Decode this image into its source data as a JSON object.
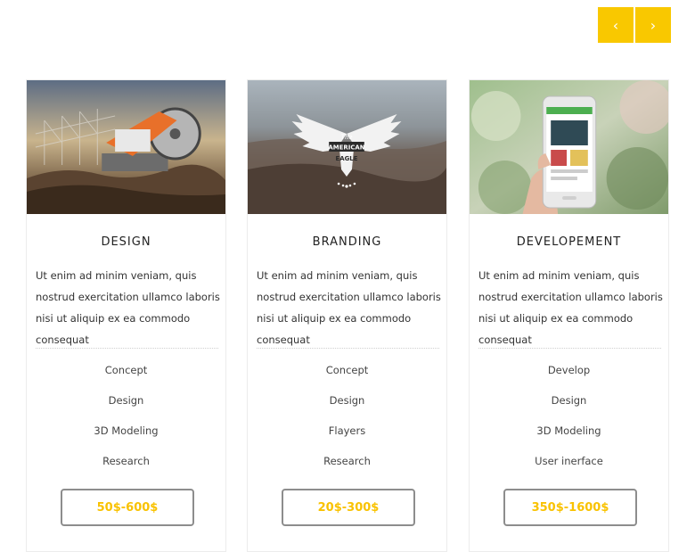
{
  "nav": {
    "prev_icon": "‹",
    "next_icon": "›",
    "accent_color": "#f9c800"
  },
  "cards": [
    {
      "image": "circular-saw-on-construction-site",
      "title": "DESIGN",
      "description": "Ut enim ad minim veniam, quis nostrud exercitation ullamco laboris nisi ut aliquip ex ea commodo consequat",
      "features": [
        "Concept",
        "Design",
        "3D Modeling",
        "Research"
      ],
      "price": "50$-600$"
    },
    {
      "image": "american-eagle-logo-over-landscape",
      "title": "BRANDING",
      "description": "Ut enim ad minim veniam, quis nostrud exercitation ullamco laboris nisi ut aliquip ex ea commodo consequat",
      "features": [
        "Concept",
        "Design",
        "Flayers",
        "Research"
      ],
      "price": "20$-300$",
      "logo_text": [
        "The",
        "AMERICAN",
        "EAGLE"
      ]
    },
    {
      "image": "hand-holding-smartphone",
      "title": "DEVELOPEMENT",
      "description": "Ut enim ad minim veniam, quis nostrud exercitation ullamco laboris nisi ut aliquip ex ea commodo consequat",
      "features": [
        "Develop",
        "Design",
        "3D Modeling",
        "User inerface"
      ],
      "price": "350$-1600$"
    }
  ]
}
